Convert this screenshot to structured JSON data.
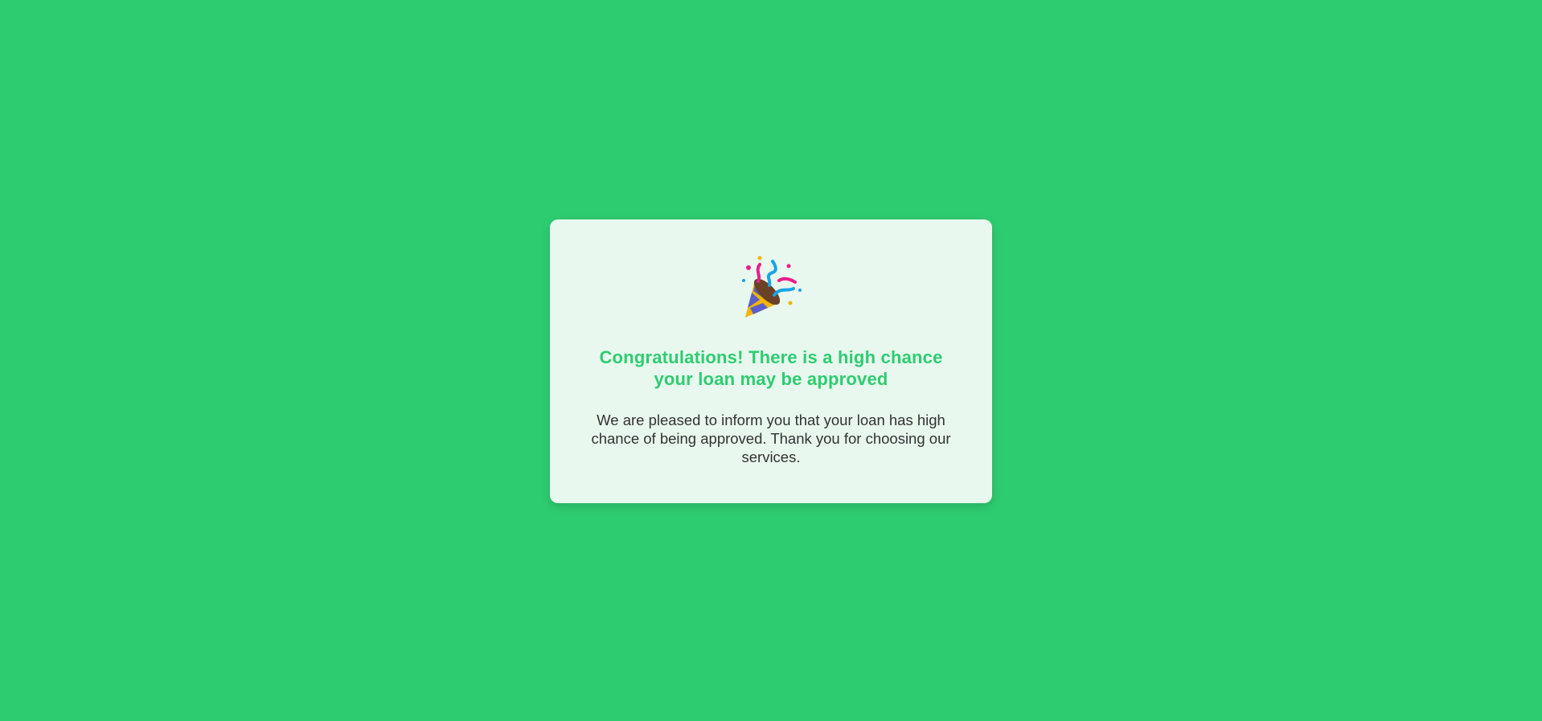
{
  "card": {
    "icon": "party-popper-icon",
    "title": "Congratulations! There is a high chance your loan may be approved",
    "message": "We are pleased to inform you that your loan has high chance of being approved. Thank you for choosing our services."
  },
  "colors": {
    "background": "#2ecc71",
    "card_background": "#e8f8ee",
    "title": "#2ecc71",
    "message": "#333333"
  }
}
